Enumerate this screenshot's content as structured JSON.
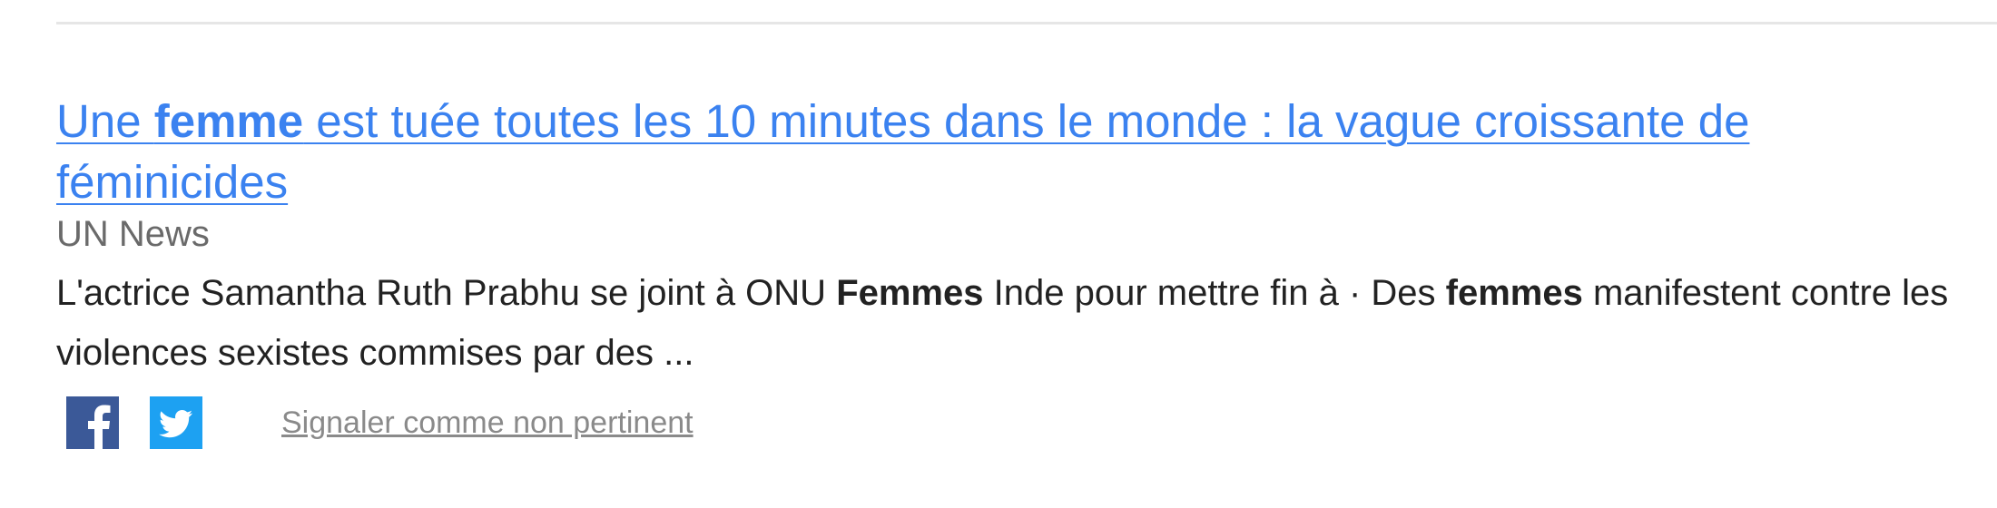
{
  "result": {
    "title_parts": [
      "Une ",
      "femme",
      " est tuée toutes les 10 minutes dans le monde : la vague croissante de féminicides"
    ],
    "source": "UN News",
    "snippet_parts": [
      "L'actrice Samantha Ruth Prabhu se joint à ONU ",
      "Femmes",
      " Inde pour mettre fin à · Des ",
      "femmes",
      " manifestent contre les violences sexistes commises par des ..."
    ],
    "share": {
      "facebook_icon": "facebook-icon",
      "twitter_icon": "twitter-icon"
    },
    "report_label": "Signaler comme non pertinent"
  },
  "colors": {
    "link": "#3b82f0",
    "source": "#6a6a6a",
    "snippet": "#222222",
    "facebook": "#3b5998",
    "twitter": "#1da1f2",
    "report": "#8a8a8a"
  }
}
